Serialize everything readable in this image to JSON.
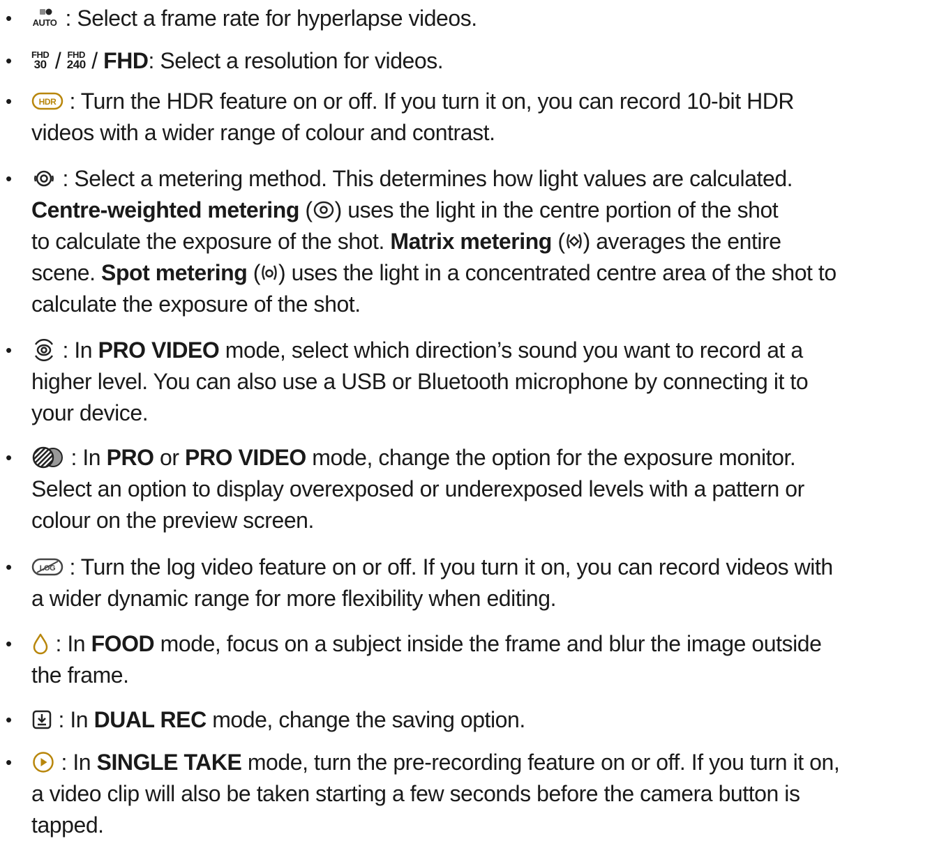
{
  "colors": {
    "text": "#1a1a1a",
    "accent_gold": "#b8860b",
    "icon_grey": "#555555"
  },
  "items": [
    {
      "icon": "hyperlapse-frame-rate-icon",
      "icon_label": "AUTO",
      "lines": [
        ": Select a frame rate for hyperlapse videos."
      ]
    },
    {
      "icon": "video-resolution-icons",
      "res_icon_1": {
        "top": "FHD",
        "bottom": "30"
      },
      "res_icon_2": {
        "top": "FHD",
        "bottom": "240"
      },
      "sep": "/",
      "fhd": "FHD",
      "lines": [
        ": Select a resolution for videos."
      ]
    },
    {
      "icon": "hdr-icon",
      "icon_label": "HDR",
      "lines": [
        ": Turn the HDR feature on or off. If you turn it on, you can record 10-bit HDR",
        "videos with a wider range of colour and contrast."
      ]
    },
    {
      "icon": "metering-icon",
      "line1": ": Select a metering method. This determines how light values are calculated.",
      "centre_label": "Centre-weighted metering",
      "line2_rest": ") uses the light in the centre portion of the shot",
      "line3_a": "to calculate the exposure of the shot.",
      "matrix_label": "Matrix metering",
      "line3_rest": ") averages the entire",
      "line4_a": "scene.",
      "spot_label": "Spot metering",
      "line4_rest": ") uses the light in a concentrated centre area of the shot to",
      "line5": "calculate the exposure of the shot."
    },
    {
      "icon": "audio-direction-icon",
      "line1_a": ": In",
      "mode": "PRO VIDEO",
      "line1_rest": "mode, select which direction’s sound you want to record at a",
      "line2": "higher level. You can also use a USB or Bluetooth microphone by connecting it to",
      "line3": "your device."
    },
    {
      "icon": "exposure-monitor-icon",
      "line1_a": ": In",
      "mode1": "PRO",
      "or": "or",
      "mode2": "PRO VIDEO",
      "line1_rest": "mode, change the option for the exposure monitor.",
      "line2": "Select an option to display overexposed or underexposed levels with a pattern or",
      "line3": "colour on the preview screen."
    },
    {
      "icon": "log-video-icon",
      "icon_label": "LOG",
      "lines": [
        ": Turn the log video feature on or off. If you turn it on, you can record videos with",
        "a wider dynamic range for more flexibility when editing."
      ]
    },
    {
      "icon": "drop-icon",
      "line1_a": ": In",
      "mode": "FOOD",
      "line1_rest": "mode, focus on a subject inside the frame and blur the image outside",
      "line2": "the frame."
    },
    {
      "icon": "save-option-icon",
      "line1_a": ": In",
      "mode": "DUAL REC",
      "line1_rest": "mode, change the saving option."
    },
    {
      "icon": "pre-recording-icon",
      "line1_a": ": In",
      "mode": "SINGLE TAKE",
      "line1_rest": "mode, turn the pre-recording feature on or off. If you turn it on,",
      "line2": "a video clip will also be taken starting a few seconds before the camera button is",
      "line3": "tapped."
    }
  ],
  "bullet_char": "•"
}
